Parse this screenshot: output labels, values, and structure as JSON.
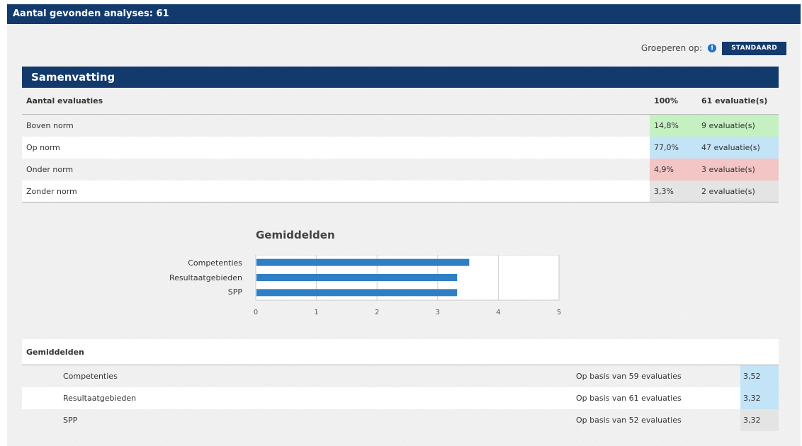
{
  "header": {
    "title": "Aantal gevonden analyses: 61"
  },
  "grouping": {
    "label": "Groeperen op:",
    "button": "STANDAARD"
  },
  "summary": {
    "title": "Samenvatting",
    "head": {
      "label": "Aantal evaluaties",
      "pct": "100%",
      "count": "61 evaluatie(s)"
    },
    "rows": [
      {
        "label": "Boven norm",
        "pct": "14,8%",
        "count": "9 evaluatie(s)",
        "color": "#c5f0c2"
      },
      {
        "label": "Op norm",
        "pct": "77,0%",
        "count": "47 evaluatie(s)",
        "color": "#c3e3f7"
      },
      {
        "label": "Onder norm",
        "pct": "4,9%",
        "count": "3 evaluatie(s)",
        "color": "#f3c5c5"
      },
      {
        "label": "Zonder norm",
        "pct": "3,3%",
        "count": "2 evaluatie(s)",
        "color": "#e4e4e4"
      }
    ]
  },
  "chart_data": {
    "type": "bar",
    "orientation": "horizontal",
    "title": "Gemiddelden",
    "categories": [
      "Competenties",
      "Resultaatgebieden",
      "SPP"
    ],
    "values": [
      3.52,
      3.32,
      3.32
    ],
    "xlim": [
      0,
      5
    ],
    "ticks": [
      "0",
      "1",
      "2",
      "3",
      "4",
      "5"
    ],
    "bar_color": "#2f7fc5",
    "grid": true
  },
  "averages": {
    "title": "Gemiddelden",
    "rows": [
      {
        "name": "Competenties",
        "basis": "Op basis van 59 evaluaties",
        "value": "3,52"
      },
      {
        "name": "Resultaatgebieden",
        "basis": "Op basis van 61 evaluaties",
        "value": "3,32"
      },
      {
        "name": "SPP",
        "basis": "Op basis van 52 evaluaties",
        "value": "3,32"
      }
    ]
  }
}
